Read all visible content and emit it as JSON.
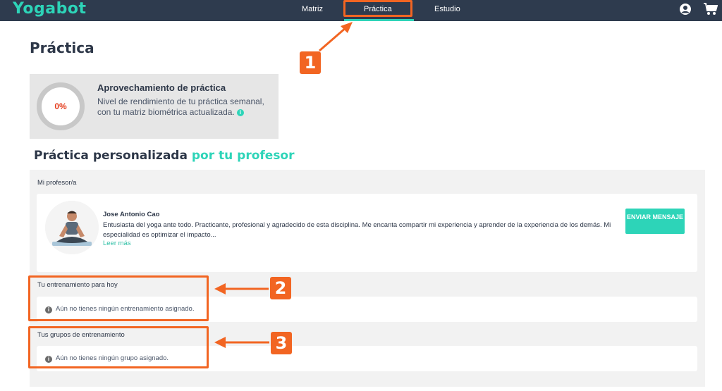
{
  "app": {
    "logo": "Yogabot",
    "nav": [
      "Matriz",
      "Práctica",
      "Estudio"
    ]
  },
  "page": {
    "title": "Práctica"
  },
  "stat_card": {
    "value": "0%",
    "progress": 0,
    "title": "Aprovechamiento de práctica",
    "description": "Nivel de rendimiento de tu práctica semanal, con tu matriz biométrica actualizada."
  },
  "section": {
    "title": "Práctica personalizada",
    "title_accent": "por tu profesor"
  },
  "teacher": {
    "section_label": "Mi profesor/a",
    "name": "Jose Antonio Cao",
    "bio": "Entusiasta del yoga ante todo. Practicante, profesional y agradecido de esta disciplina. Me encanta compartir mi experiencia y aprender de la experiencia de los demás. Mi especialidad es optimizar el impacto...",
    "more_link": "Leer más",
    "message_button": "ENVIAR MENSAJE"
  },
  "training_today": {
    "label": "Tu entrenamiento para hoy",
    "empty": "Aún no tienes ningún entrenamiento asignado."
  },
  "training_groups": {
    "label": "Tus grupos de entrenamiento",
    "empty": "Aún no tienes ningún grupo asignado."
  },
  "annotations": [
    "1",
    "2",
    "3"
  ],
  "colors": {
    "nav_bg": "#2e3b4e",
    "accent": "#2dd4b8",
    "highlight": "#f26522",
    "percent": "#e53e1f"
  },
  "icons": [
    "user-circle-icon",
    "cart-icon",
    "info-icon",
    "arrow-icon"
  ]
}
